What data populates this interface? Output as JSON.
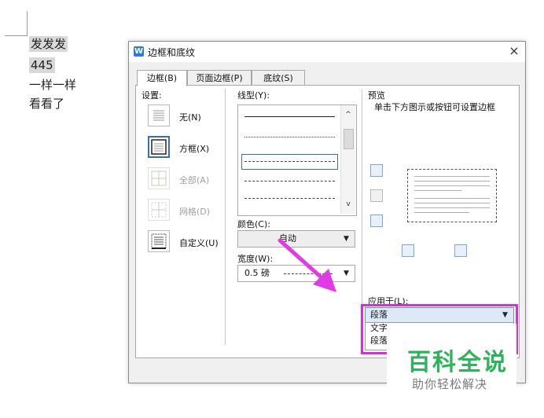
{
  "document": {
    "lines": [
      "发发发",
      "445",
      "一样一样",
      "看看了"
    ]
  },
  "dialog": {
    "title": "边框和底纹",
    "close_glyph": "×",
    "tabs": [
      {
        "label": "边框(B)"
      },
      {
        "label": "页面边框(P)"
      },
      {
        "label": "底纹(S)"
      }
    ],
    "settings": {
      "label": "设置:",
      "items": [
        {
          "label": "无(N)"
        },
        {
          "label": "方框(X)"
        },
        {
          "label": "全部(A)"
        },
        {
          "label": "网格(D)"
        },
        {
          "label": "自定义(U)"
        }
      ]
    },
    "line_style": {
      "label": "线型(Y):",
      "scroll_up": "^",
      "scroll_down": "v"
    },
    "color": {
      "label": "颜色(C):",
      "value": "自动",
      "arrow": "▼"
    },
    "width": {
      "label": "宽度(W):",
      "value": "0.5  磅",
      "arrow": "▼"
    },
    "preview": {
      "label": "预览",
      "hint": "单击下方图示或按钮可设置边框"
    },
    "apply_to": {
      "label": "应用于(L):",
      "value": "段落",
      "arrow": "▼",
      "options": [
        "文字",
        "段落"
      ]
    }
  },
  "watermark": {
    "main": "百科全说",
    "sub": "助你轻松解决"
  },
  "colors": {
    "accent_blue": "#2b7bd9",
    "highlight_magenta": "#d42fd9",
    "watermark_green": "#2eb35a"
  }
}
